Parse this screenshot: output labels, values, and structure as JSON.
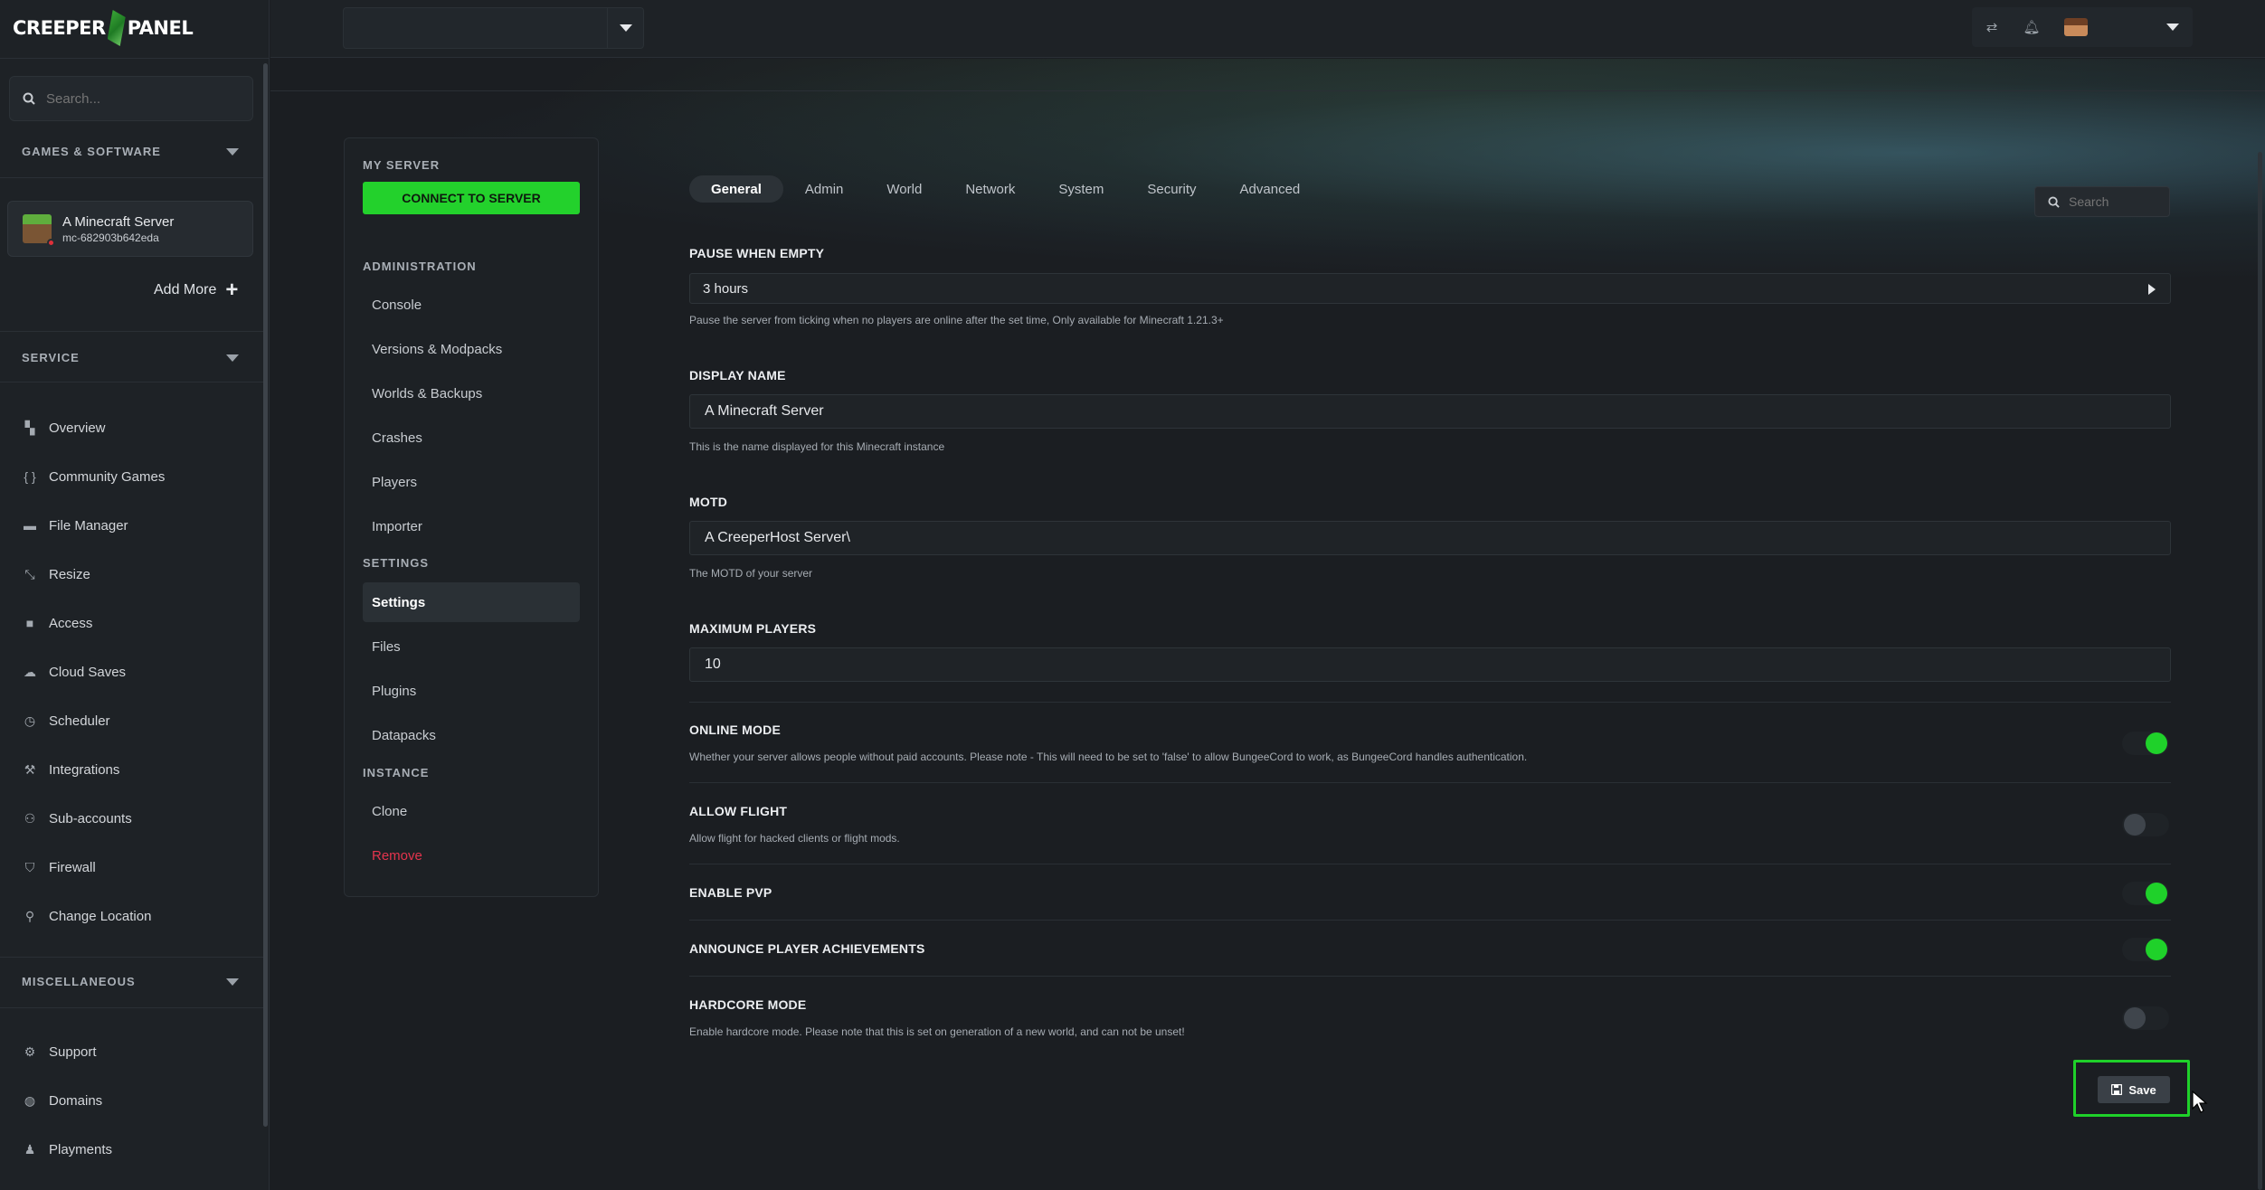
{
  "brand": {
    "logo_left": "CREEPER",
    "logo_right": "PANEL"
  },
  "sidebar": {
    "search_placeholder": "Search...",
    "sections": {
      "games": "GAMES & SOFTWARE",
      "service": "SERVICE",
      "misc": "MISCELLANEOUS"
    },
    "server": {
      "name": "A Minecraft Server",
      "id": "mc-682903b642eda"
    },
    "add_more": "Add More",
    "service_items": [
      {
        "label": "Overview",
        "icon": "grid-icon"
      },
      {
        "label": "Community Games",
        "icon": "brackets-icon"
      },
      {
        "label": "File Manager",
        "icon": "folder-icon"
      },
      {
        "label": "Resize",
        "icon": "resize-icon"
      },
      {
        "label": "Access",
        "icon": "lock-icon"
      },
      {
        "label": "Cloud Saves",
        "icon": "cloud-icon"
      },
      {
        "label": "Scheduler",
        "icon": "clock-icon"
      },
      {
        "label": "Integrations",
        "icon": "wrench-icon"
      },
      {
        "label": "Sub-accounts",
        "icon": "users-icon"
      },
      {
        "label": "Firewall",
        "icon": "shield-icon"
      },
      {
        "label": "Change Location",
        "icon": "pin-icon"
      }
    ],
    "misc_items": [
      {
        "label": "Support",
        "icon": "support-icon"
      },
      {
        "label": "Domains",
        "icon": "globe-icon"
      },
      {
        "label": "Playments",
        "icon": "piggy-bank-icon"
      }
    ]
  },
  "submenu": {
    "my_server": "MY SERVER",
    "connect": "CONNECT TO SERVER",
    "administration": "ADMINISTRATION",
    "admin_items": [
      "Console",
      "Versions & Modpacks",
      "Worlds & Backups",
      "Crashes",
      "Players",
      "Importer"
    ],
    "settings_head": "SETTINGS",
    "settings_items": [
      "Settings",
      "Files",
      "Plugins",
      "Datapacks"
    ],
    "instance_head": "INSTANCE",
    "instance_items": [
      "Clone",
      "Remove"
    ]
  },
  "tabs": [
    "General",
    "Admin",
    "World",
    "Network",
    "System",
    "Security",
    "Advanced"
  ],
  "form_search_placeholder": "Search",
  "form": {
    "pause": {
      "label": "PAUSE WHEN EMPTY",
      "value": "3 hours",
      "help": "Pause the server from ticking when no players are online after the set time, Only available for Minecraft 1.21.3+"
    },
    "display_name": {
      "label": "DISPLAY NAME",
      "value": "A Minecraft Server",
      "help": "This is the name displayed for this Minecraft instance"
    },
    "motd": {
      "label": "MOTD",
      "value": "A CreeperHost Server\\",
      "help": "The MOTD of your server"
    },
    "max_players": {
      "label": "MAXIMUM PLAYERS",
      "value": "10"
    },
    "online_mode": {
      "label": "ONLINE MODE",
      "help": "Whether your server allows people without paid accounts. Please note - This will need to be set to 'false' to allow BungeeCord to work, as BungeeCord handles authentication.",
      "on": true
    },
    "allow_flight": {
      "label": "ALLOW FLIGHT",
      "help": "Allow flight for hacked clients or flight mods.",
      "on": false
    },
    "enable_pvp": {
      "label": "ENABLE PVP",
      "on": true
    },
    "announce": {
      "label": "ANNOUNCE PLAYER ACHIEVEMENTS",
      "on": true
    },
    "hardcore": {
      "label": "HARDCORE MODE",
      "help": "Enable hardcore mode. Please note that this is set on generation of a new world, and can not be unset!",
      "on": false
    }
  },
  "save_label": "Save",
  "colors": {
    "accent_green": "#23d12c",
    "danger": "#e4344d"
  }
}
